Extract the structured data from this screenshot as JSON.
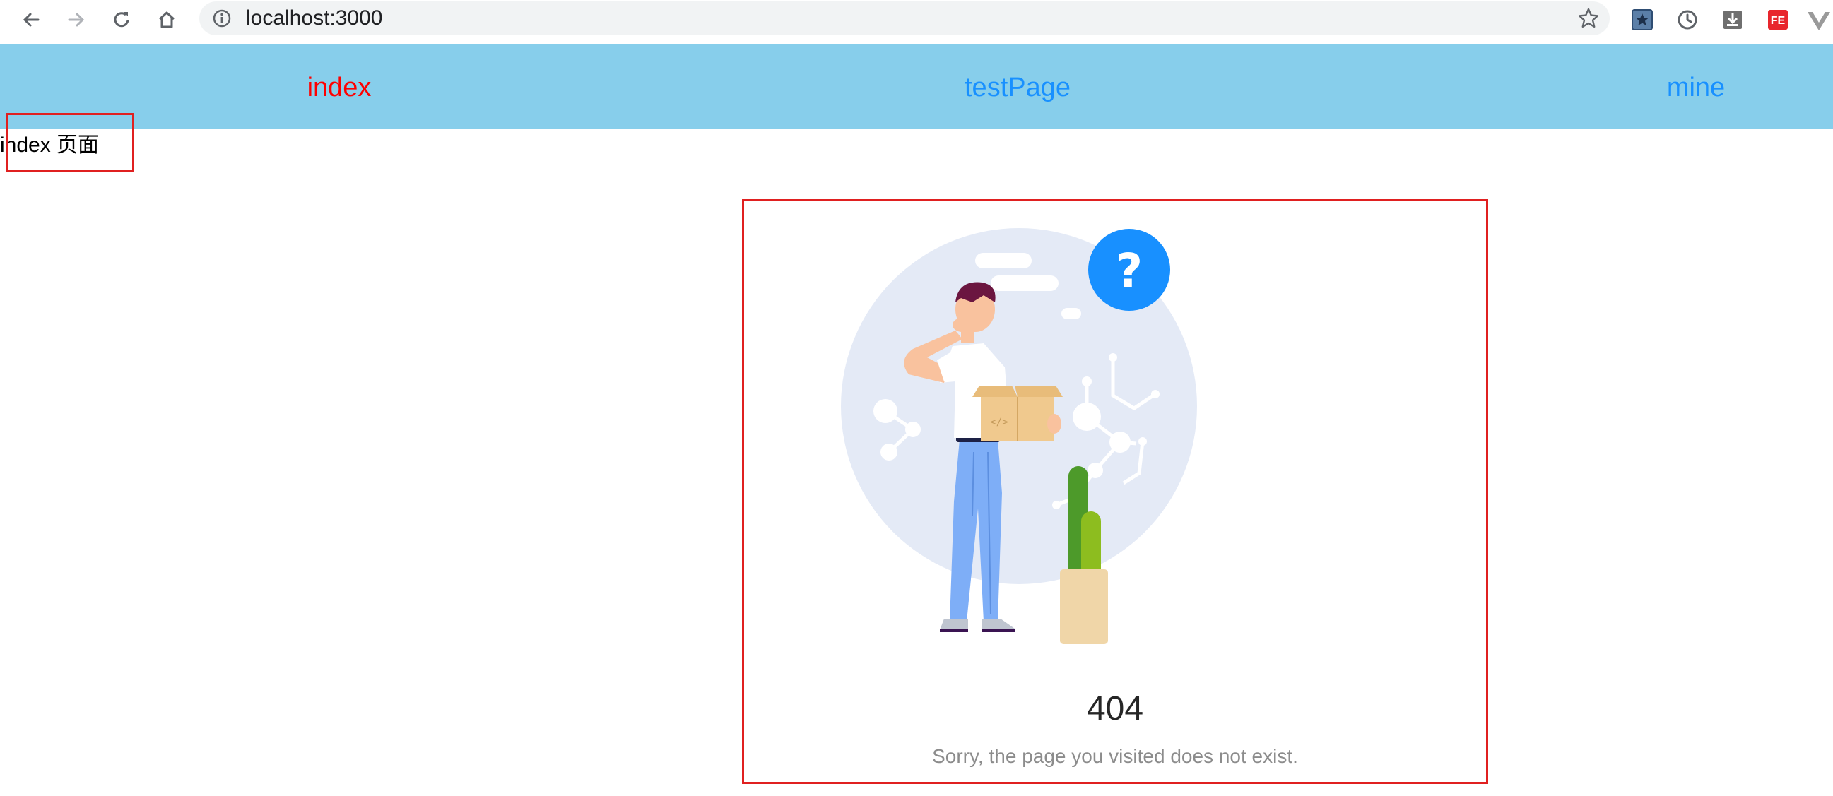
{
  "browser": {
    "url": "localhost:3000",
    "extensions": [
      "bookmark-extension-icon",
      "history-icon",
      "download-icon",
      "fe-extension-icon",
      "vue-devtools-icon"
    ],
    "extension_fe_label": "FE"
  },
  "topnav": {
    "bg_color": "#87ceeb",
    "items": [
      {
        "label": "index",
        "color": "#ff0000",
        "active": true
      },
      {
        "label": "testPage",
        "color": "#1890ff",
        "active": false
      },
      {
        "label": "mine",
        "color": "#1890ff",
        "active": false
      }
    ]
  },
  "page_label": "index 页面",
  "result": {
    "status": "404",
    "subtitle": "Sorry, the page you visited does not exist.",
    "illustration_badge": "?"
  },
  "colors": {
    "highlight_border": "#e02020",
    "accent": "#1890ff"
  }
}
